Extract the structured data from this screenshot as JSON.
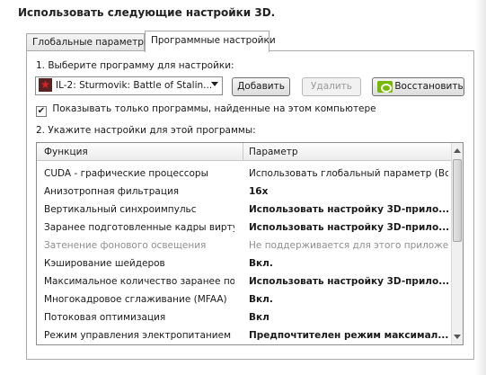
{
  "heading": "Использовать следующие настройки 3D.",
  "tabs": [
    "Глобальные параметры",
    "Программные настройки"
  ],
  "step1_label": "1. Выберите программу для настройки:",
  "program_select": {
    "value": "IL-2: Sturmovik: Battle of Stalin...",
    "icon": "star-icon"
  },
  "buttons": {
    "add": "Добавить",
    "remove": "Удалить",
    "restore": "Восстановить"
  },
  "show_only_checkbox": {
    "label": "Показывать только программы, найденные на этом компьютере",
    "checked": true
  },
  "step2_label": "2. Укажите настройки для этой программы:",
  "table": {
    "headers": [
      "Функция",
      "Параметр"
    ],
    "rows": [
      {
        "feature": "CUDA - графические процессоры",
        "value": "Использовать глобальный параметр (Все)",
        "style": "normal"
      },
      {
        "feature": "Анизотропная фильтрация",
        "value": "16x",
        "style": "bold"
      },
      {
        "feature": "Вертикальный синхроимпульс",
        "value": "Использовать настройку 3D-прило...",
        "style": "bold"
      },
      {
        "feature": "Заранее подготовленные кадры вирту...",
        "value": "Использовать настройку 3D-прило...",
        "style": "bold"
      },
      {
        "feature": "Затенение фонового освещения",
        "value": "Не поддерживается для этого приложе...",
        "style": "disabled"
      },
      {
        "feature": "Кэширование шейдеров",
        "value": "Вкл.",
        "style": "bold"
      },
      {
        "feature": "Максимальное количество заранее под...",
        "value": "Использовать настройку 3D-прило...",
        "style": "bold"
      },
      {
        "feature": "Многокадровое сглаживание (MFAA)",
        "value": "Вкл.",
        "style": "bold"
      },
      {
        "feature": "Потоковая оптимизация",
        "value": "Вкл",
        "style": "bold"
      },
      {
        "feature": "Режим управления электропитанием",
        "value": "Предпочтителен режим максимал...",
        "style": "bold"
      }
    ]
  }
}
